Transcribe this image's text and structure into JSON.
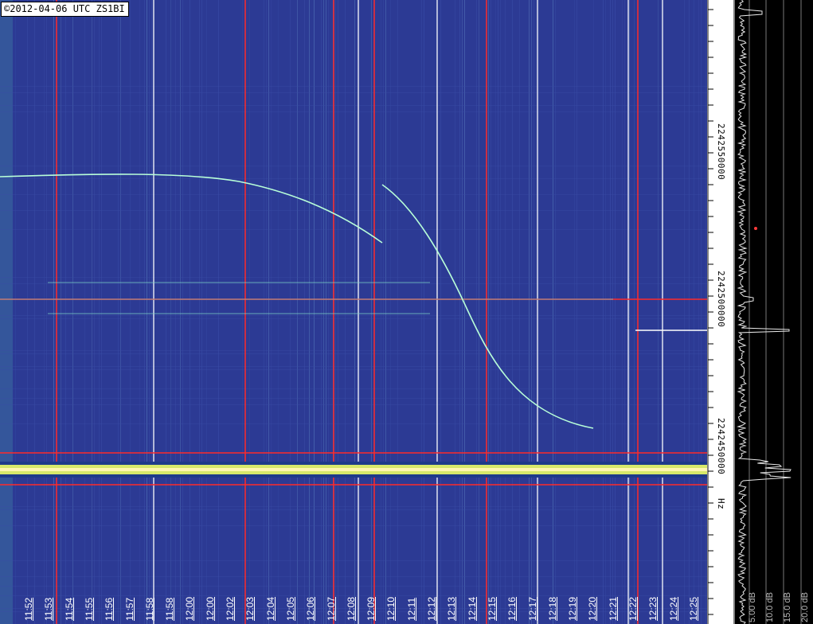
{
  "copyright": "©2012-04-06 UTC ZS1BI",
  "chart_data": {
    "type": "heatmap",
    "x_axis": {
      "tick_labels": [
        "11:52",
        "11:53",
        "11:54",
        "11:55",
        "11:56",
        "11:57",
        "11:58",
        "11:58",
        "12:00",
        "12:00",
        "12:02",
        "12:03",
        "12:04",
        "12:05",
        "12:06",
        "12:07",
        "12:08",
        "12:09",
        "12:10",
        "12:11",
        "12:12",
        "12:13",
        "12:14",
        "12:15",
        "12:16",
        "12:17",
        "12:18",
        "12:19",
        "12:20",
        "12:21",
        "12:22",
        "12:23",
        "12:24",
        "12:25"
      ]
    },
    "y_axis": {
      "unit": "Hz",
      "range": [
        2242420000,
        2242570000
      ],
      "labels": [
        {
          "text": "2242550000",
          "value": 2242550000
        },
        {
          "text": "2242500000",
          "value": 2242500000
        },
        {
          "text": "2242450000",
          "value": 2242450000
        }
      ]
    },
    "power_scale": {
      "labels": [
        "5.00 dB",
        "10.0 dB",
        "15.0 dB",
        "20.0 dB"
      ]
    }
  },
  "colors": {
    "background": "#2c3a94",
    "grid_white": "#ffffff",
    "grid_red": "#ff2a2a",
    "trace": "#b8ffd8",
    "carrier": "#ffff88"
  }
}
